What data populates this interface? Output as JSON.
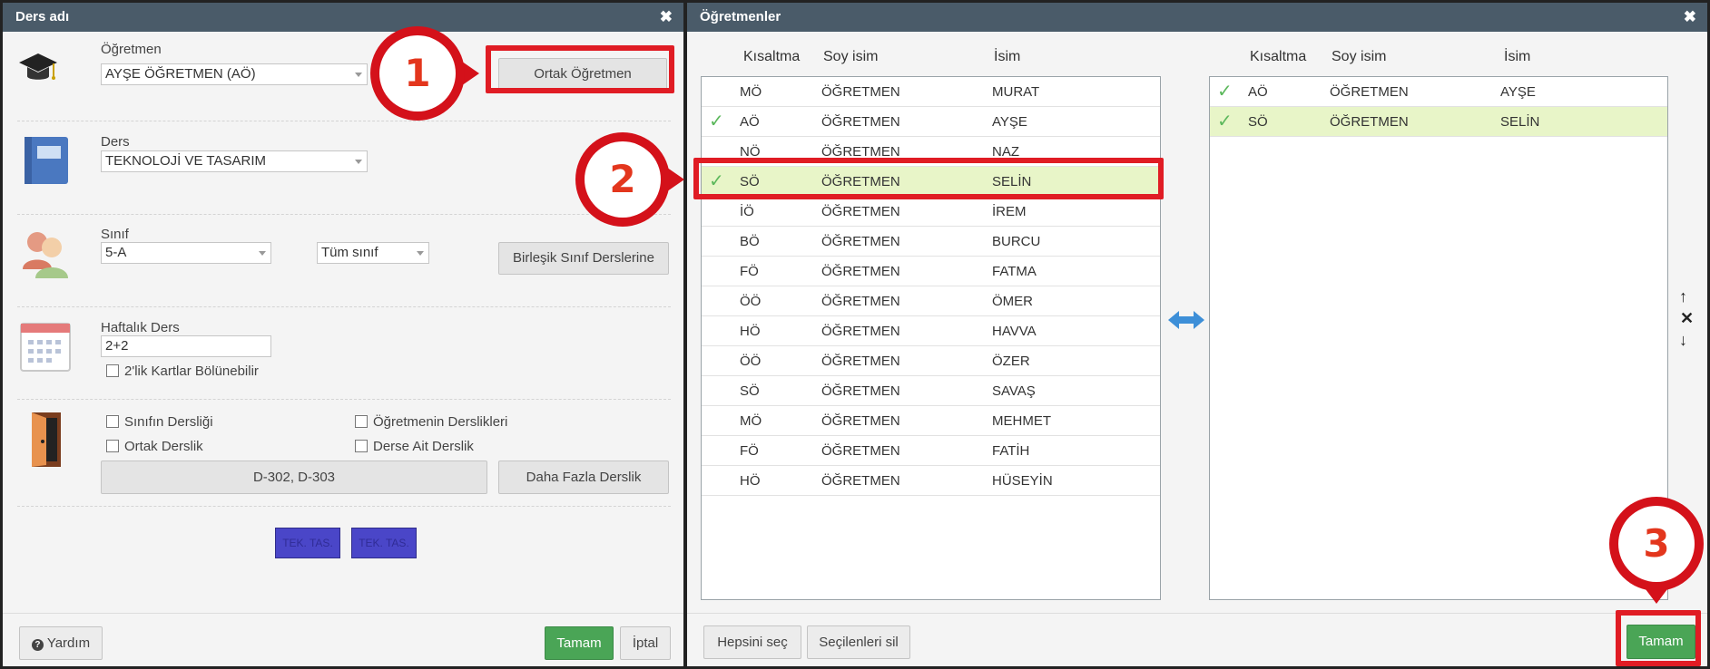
{
  "left_window": {
    "title": "Ders adı",
    "teacher_label": "Öğretmen",
    "teacher_value": "AYŞE ÖĞRETMEN (AÖ)",
    "common_teacher_button": "Ortak Öğretmen",
    "lesson_label": "Ders",
    "lesson_value": "TEKNOLOJİ VE TASARIM",
    "class_label": "Sınıf",
    "class_value": "5-A",
    "group_value": "Tüm sınıf",
    "joint_class_button": "Birleşik Sınıf Derslerine",
    "weekly_label": "Haftalık Ders",
    "weekly_value": "2+2",
    "split_cards_label": "2'lik Kartlar Bölünebilir",
    "room_class_label": "Sınıfın Dersliği",
    "room_teacher_label": "Öğretmenin Derslikleri",
    "room_common_label": "Ortak Derslik",
    "room_lesson_label": "Derse Ait Derslik",
    "rooms_value": "D-302, D-303",
    "more_rooms_button": "Daha Fazla Derslik",
    "card_1": "TEK. TAS.",
    "card_2": "TEK. TAS.",
    "help_button": "Yardım",
    "ok_button": "Tamam",
    "cancel_button": "İptal"
  },
  "right_window": {
    "title": "Öğretmenler",
    "columns": [
      "Kısaltma",
      "Soy isim",
      "İsim"
    ],
    "all_teachers": [
      {
        "abbr": "MÖ",
        "surname": "ÖĞRETMEN",
        "name": "MURAT",
        "checked": false
      },
      {
        "abbr": "AÖ",
        "surname": "ÖĞRETMEN",
        "name": "AYŞE",
        "checked": true
      },
      {
        "abbr": "NÖ",
        "surname": "ÖĞRETMEN",
        "name": "NAZ",
        "checked": false
      },
      {
        "abbr": "SÖ",
        "surname": "ÖĞRETMEN",
        "name": "SELİN",
        "checked": true
      },
      {
        "abbr": "İÖ",
        "surname": "ÖĞRETMEN",
        "name": "İREM",
        "checked": false
      },
      {
        "abbr": "BÖ",
        "surname": "ÖĞRETMEN",
        "name": "BURCU",
        "checked": false
      },
      {
        "abbr": "FÖ",
        "surname": "ÖĞRETMEN",
        "name": "FATMA",
        "checked": false
      },
      {
        "abbr": "ÖÖ",
        "surname": "ÖĞRETMEN",
        "name": "ÖMER",
        "checked": false
      },
      {
        "abbr": "HÖ",
        "surname": "ÖĞRETMEN",
        "name": "HAVVA",
        "checked": false
      },
      {
        "abbr": "ÖÖ",
        "surname": "ÖĞRETMEN",
        "name": "ÖZER",
        "checked": false
      },
      {
        "abbr": "SÖ",
        "surname": "ÖĞRETMEN",
        "name": "SAVAŞ",
        "checked": false
      },
      {
        "abbr": "MÖ",
        "surname": "ÖĞRETMEN",
        "name": "MEHMET",
        "checked": false
      },
      {
        "abbr": "FÖ",
        "surname": "ÖĞRETMEN",
        "name": "FATİH",
        "checked": false
      },
      {
        "abbr": "HÖ",
        "surname": "ÖĞRETMEN",
        "name": "HÜSEYİN",
        "checked": false
      }
    ],
    "selected_teachers": [
      {
        "abbr": "AÖ",
        "surname": "ÖĞRETMEN",
        "name": "AYŞE"
      },
      {
        "abbr": "SÖ",
        "surname": "ÖĞRETMEN",
        "name": "SELİN"
      }
    ],
    "select_all_button": "Hepsini seç",
    "delete_selected_button": "Seçilenleri sil",
    "ok_button": "Tamam"
  },
  "annotations": {
    "step_1": "1",
    "step_2": "2",
    "step_3": "3"
  },
  "colors": {
    "highlight_red": "#e01c24",
    "selected_row": "#e8f5c8",
    "ok_green": "#4aa556",
    "card_purple": "#4a46c8",
    "titlebar": "#4a5b69"
  }
}
